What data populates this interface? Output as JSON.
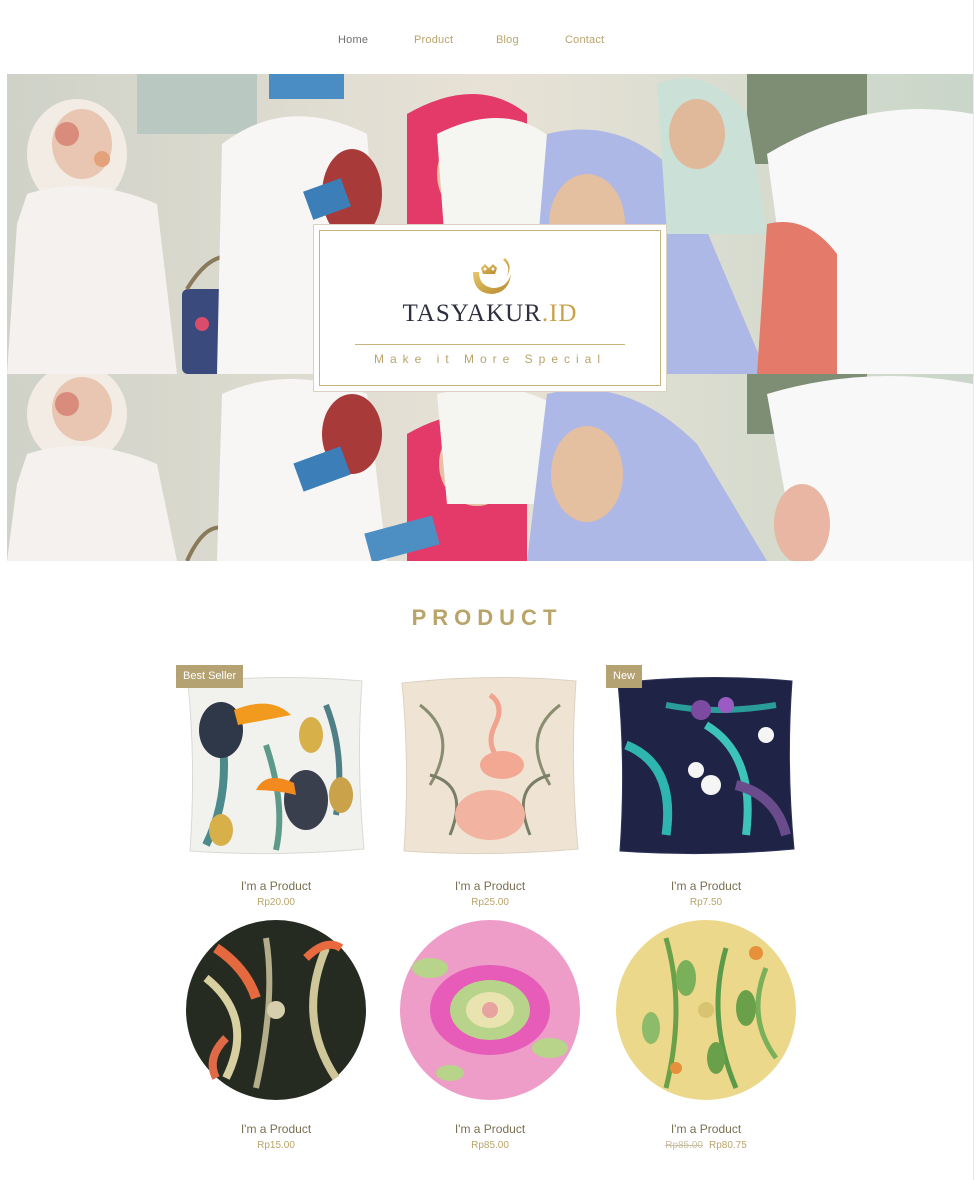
{
  "nav": {
    "items": [
      {
        "label": "Home",
        "active": true
      },
      {
        "label": "Product",
        "active": false
      },
      {
        "label": "Blog",
        "active": false
      },
      {
        "label": "Contact",
        "active": false
      }
    ]
  },
  "hero": {
    "photo": "women-in-hijab-reading-photo",
    "logo": {
      "icon": "gold-crescent-crown-logo-icon",
      "brand_main": "TASYAKUR",
      "brand_suffix": ".ID",
      "tagline": "Make it More Special"
    }
  },
  "products_section": {
    "title": "PRODUCT",
    "items": [
      {
        "name": "I'm a Product",
        "price": "Rp20.00",
        "badge": "Best Seller",
        "image": "toucan-pineapple-square-pillow"
      },
      {
        "name": "I'm a Product",
        "price": "Rp25.00",
        "badge": null,
        "image": "flamingo-palm-square-pillow"
      },
      {
        "name": "I'm a Product",
        "price": "Rp7.50",
        "badge": "New",
        "image": "orchid-tropical-square-pillow"
      },
      {
        "name": "I'm a Product",
        "price": "Rp15.00",
        "badge": null,
        "image": "bird-of-paradise-round-pillow"
      },
      {
        "name": "I'm a Product",
        "price": "Rp85.00",
        "badge": null,
        "image": "pink-ikat-round-pillow"
      },
      {
        "name": "I'm a Product",
        "price": "Rp80.75",
        "old_price": "Rp85.00",
        "badge": null,
        "image": "yellow-botanical-round-pillow"
      }
    ]
  },
  "colors": {
    "accent_gold": "#b9a46a",
    "badge_bg": "#b4a273",
    "nav_active": "#6f6f6f",
    "brand_navy": "#2e3040"
  }
}
